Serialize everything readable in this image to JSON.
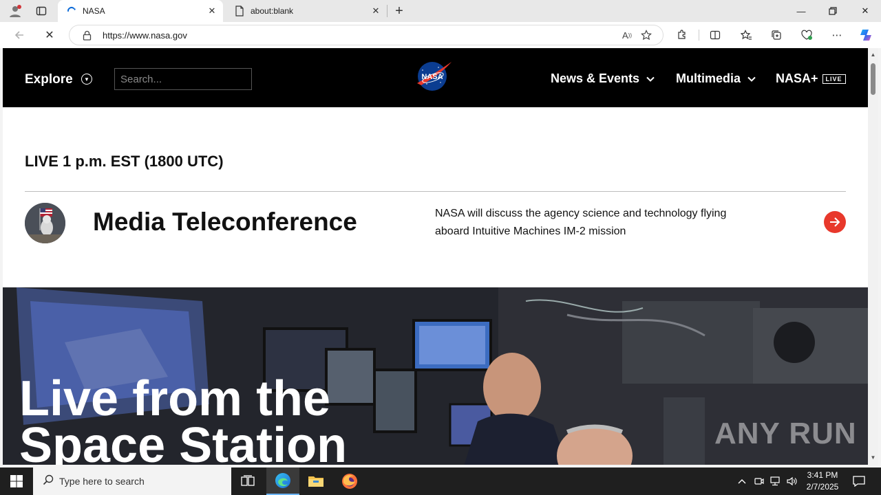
{
  "browser": {
    "tabs": [
      {
        "title": "NASA",
        "active": true
      },
      {
        "title": "about:blank",
        "active": false
      }
    ],
    "url": "https://www.nasa.gov"
  },
  "site": {
    "nav": {
      "explore_label": "Explore",
      "search_placeholder": "Search...",
      "logo_text": "NASA",
      "menu": [
        {
          "label": "News & Events"
        },
        {
          "label": "Multimedia"
        },
        {
          "label": "NASA+",
          "badge": "LIVE"
        }
      ]
    },
    "event": {
      "time": "LIVE 1 p.m. EST (1800 UTC)",
      "title": "Media Teleconference",
      "description": "NASA will discuss the agency science and technology flying aboard Intuitive Machines IM-2 mission"
    },
    "hero": {
      "title_line1": "Live from the",
      "title_line2": "Space Station"
    },
    "watermark": "ANY RUN"
  },
  "taskbar": {
    "search_placeholder": "Type here to search",
    "time": "3:41 PM",
    "date": "2/7/2025"
  },
  "colors": {
    "nasa_red": "#e8382b",
    "nasa_blue": "#0b3d91",
    "header_bg": "#000000"
  }
}
